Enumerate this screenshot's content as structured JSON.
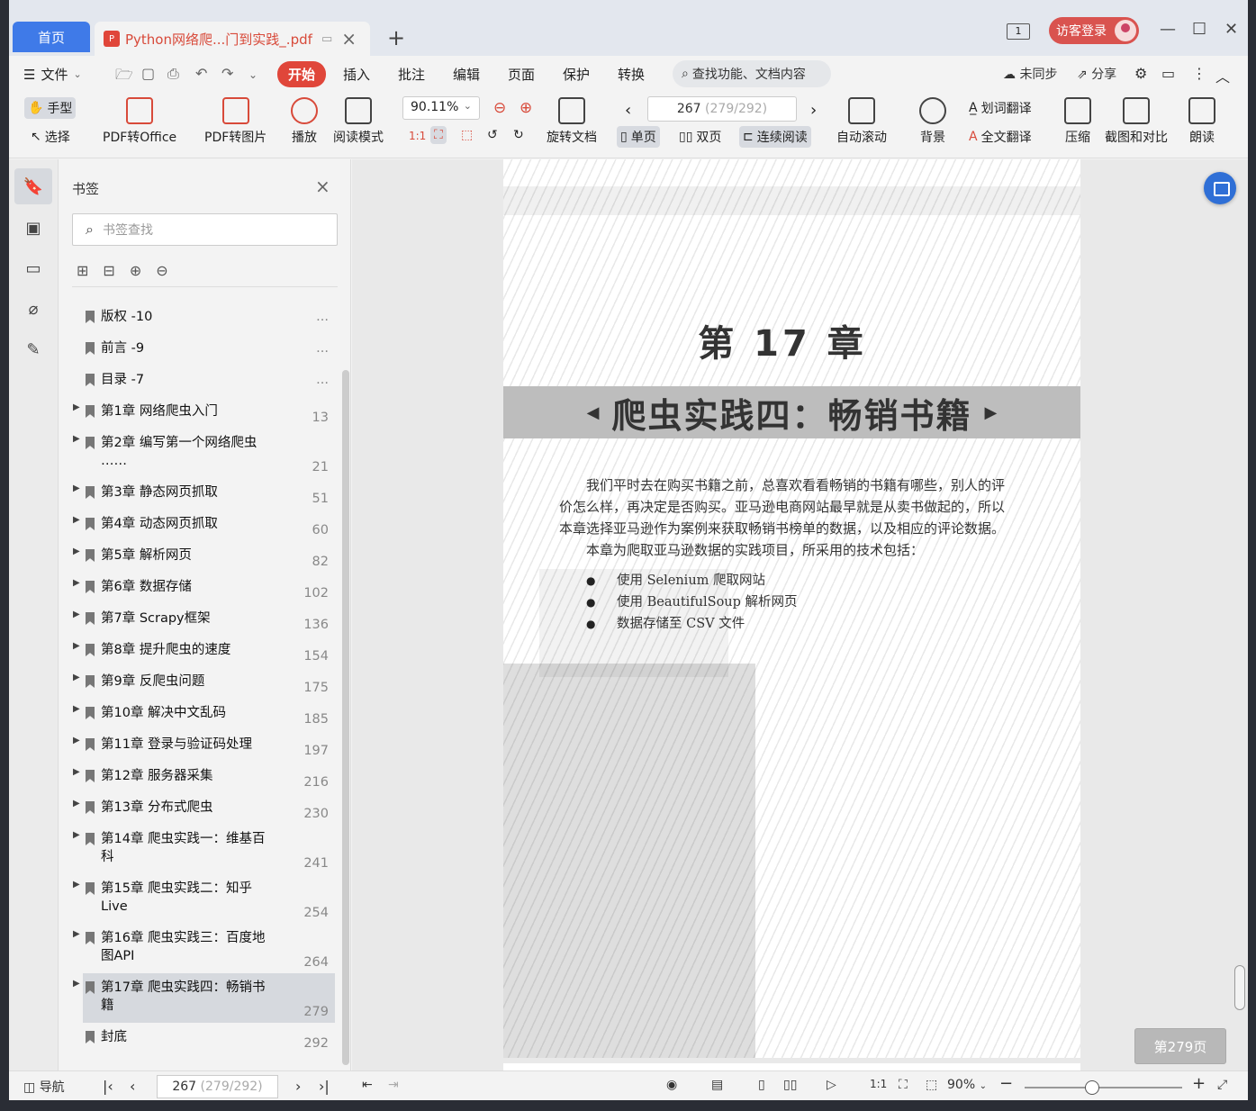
{
  "tabs": {
    "home": "首页",
    "doc_title": "Python网络爬...门到实践_.pdf",
    "add": "+"
  },
  "titlebar": {
    "window_count": "1",
    "login": "访客登录",
    "minimize": "—",
    "maximize": "☐",
    "close": "✕"
  },
  "menu": {
    "file": "文件",
    "tabs": [
      "开始",
      "插入",
      "批注",
      "编辑",
      "页面",
      "保护",
      "转换"
    ],
    "search_placeholder": "查找功能、文档内容",
    "sync": "未同步",
    "share": "分享"
  },
  "toolbar": {
    "hand": "手型",
    "select": "选择",
    "pdf_to_office": "PDF转Office",
    "pdf_to_image": "PDF转图片",
    "play": "播放",
    "read_mode": "阅读模式",
    "zoom": "90.11%",
    "rotate": "旋转文档",
    "page_current": "267",
    "page_extra": "(279/292)",
    "single": "单页",
    "double": "双页",
    "continuous": "连续阅读",
    "auto_scroll": "自动滚动",
    "background": "背景",
    "word_translate": "划词翻译",
    "full_translate": "全文翻译",
    "compress": "压缩",
    "screenshot": "截图和对比",
    "read_aloud": "朗读"
  },
  "bookmarks": {
    "title": "书签",
    "search_placeholder": "书签查找",
    "items": [
      {
        "label": "版权 -10",
        "page": "...",
        "expandable": false
      },
      {
        "label": "前言 -9",
        "page": "...",
        "expandable": false
      },
      {
        "label": "目录 -7",
        "page": "...",
        "expandable": false
      },
      {
        "label": "第1章 网络爬虫入门",
        "page": "13",
        "expandable": true
      },
      {
        "label": "第2章 编写第一个网络爬虫 ……",
        "page": "21",
        "expandable": true
      },
      {
        "label": "第3章 静态网页抓取",
        "page": "51",
        "expandable": true
      },
      {
        "label": "第4章 动态网页抓取",
        "page": "60",
        "expandable": true
      },
      {
        "label": "第5章 解析网页",
        "page": "82",
        "expandable": true
      },
      {
        "label": "第6章 数据存储",
        "page": "102",
        "expandable": true
      },
      {
        "label": "第7章 Scrapy框架",
        "page": "136",
        "expandable": true
      },
      {
        "label": "第8章 提升爬虫的速度",
        "page": "154",
        "expandable": true
      },
      {
        "label": "第9章 反爬虫问题",
        "page": "175",
        "expandable": true
      },
      {
        "label": "第10章 解决中文乱码",
        "page": "185",
        "expandable": true
      },
      {
        "label": "第11章 登录与验证码处理",
        "page": "197",
        "expandable": true
      },
      {
        "label": "第12章 服务器采集",
        "page": "216",
        "expandable": true
      },
      {
        "label": "第13章 分布式爬虫",
        "page": "230",
        "expandable": true
      },
      {
        "label": "第14章 爬虫实践一：维基百科",
        "page": "241",
        "expandable": true
      },
      {
        "label": "第15章 爬虫实践二：知乎Live",
        "page": "254",
        "expandable": true
      },
      {
        "label": "第16章 爬虫实践三：百度地图API",
        "page": "264",
        "expandable": true
      },
      {
        "label": "第17章 爬虫实践四：畅销书籍",
        "page": "279",
        "expandable": true
      },
      {
        "label": "封底",
        "page": "292",
        "expandable": false
      }
    ]
  },
  "page": {
    "chapter_number": "第 17 章",
    "chapter_title": "爬虫实践四：畅销书籍",
    "paragraph1": "我们平时去在购买书籍之前，总喜欢看看畅销的书籍有哪些，别人的评价怎么样，再决定是否购买。亚马逊电商网站最早就是从卖书做起的，所以本章选择亚马逊作为案例来获取畅销书榜单的数据，以及相应的评论数据。",
    "paragraph2": "本章为爬取亚马逊数据的实践项目，所采用的技术包括：",
    "bullets": [
      "使用 Selenium 爬取网站",
      "使用 BeautifulSoup 解析网页",
      "数据存储至 CSV 文件"
    ],
    "badge": "第279页"
  },
  "statusbar": {
    "nav": "导航",
    "page_current": "267",
    "page_extra": "(279/292)",
    "zoom": "90%"
  }
}
